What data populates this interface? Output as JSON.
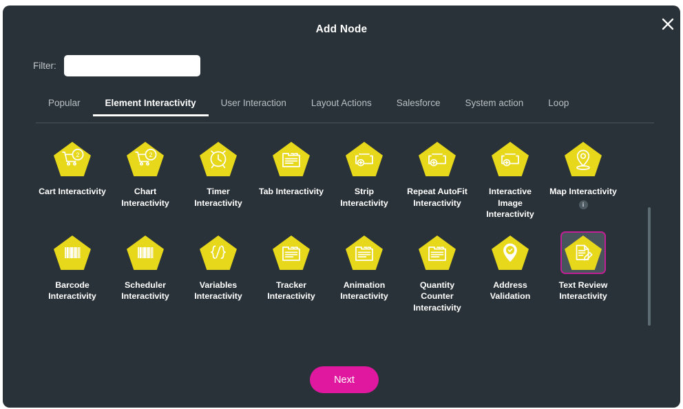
{
  "modal": {
    "title": "Add Node",
    "close_icon": "close-icon"
  },
  "filter": {
    "label": "Filter:",
    "value": "",
    "placeholder": ""
  },
  "tabs": [
    {
      "label": "Popular",
      "active": false
    },
    {
      "label": "Element Interactivity",
      "active": true
    },
    {
      "label": "User Interaction",
      "active": false
    },
    {
      "label": "Layout Actions",
      "active": false
    },
    {
      "label": "Salesforce",
      "active": false
    },
    {
      "label": "System action",
      "active": false
    },
    {
      "label": "Loop",
      "active": false
    }
  ],
  "nodes": [
    {
      "label": "Cart Interactivity",
      "icon": "shopping-cart-badge-icon",
      "selected": false,
      "info": null
    },
    {
      "label": "Chart Interactivity",
      "icon": "shopping-cart-badge-icon",
      "selected": false,
      "info": null
    },
    {
      "label": "Timer Interactivity",
      "icon": "alarm-clock-icon",
      "selected": false,
      "info": null
    },
    {
      "label": "Tab Interactivity",
      "icon": "folder-document-icon",
      "selected": false,
      "info": null
    },
    {
      "label": "Strip Interactivity",
      "icon": "rectangle-plus-icon",
      "selected": false,
      "info": null
    },
    {
      "label": "Repeat AutoFit Interactivity",
      "icon": "rectangle-plus-icon",
      "selected": false,
      "info": null
    },
    {
      "label": "Interactive Image Interactivity",
      "icon": "rectangle-plus-icon",
      "selected": false,
      "info": null
    },
    {
      "label": "Map Interactivity",
      "icon": "map-pin-icon",
      "selected": false,
      "info": "i"
    },
    {
      "label": "Barcode Interactivity",
      "icon": "barcode-icon",
      "selected": false,
      "info": null
    },
    {
      "label": "Scheduler Interactivity",
      "icon": "barcode-icon",
      "selected": false,
      "info": null
    },
    {
      "label": "Variables Interactivity",
      "icon": "code-braces-icon",
      "selected": false,
      "info": null
    },
    {
      "label": "Tracker Interactivity",
      "icon": "folder-document-icon",
      "selected": false,
      "info": null
    },
    {
      "label": "Animation Interactivity",
      "icon": "folder-document-icon",
      "selected": false,
      "info": null
    },
    {
      "label": "Quantity Counter Interactivity",
      "icon": "folder-document-icon",
      "selected": false,
      "info": null
    },
    {
      "label": "Address Validation",
      "icon": "map-pin-check-icon",
      "selected": false,
      "info": null
    },
    {
      "label": "Text Review Interactivity",
      "icon": "document-edit-icon",
      "selected": true,
      "info": null
    }
  ],
  "footer": {
    "next_label": "Next"
  },
  "colors": {
    "modal_bg": "#293238",
    "node_yellow": "#E8D81C",
    "accent_pink": "#E0189F",
    "selected_border": "#C01F95",
    "selected_bg": "#47545C"
  }
}
